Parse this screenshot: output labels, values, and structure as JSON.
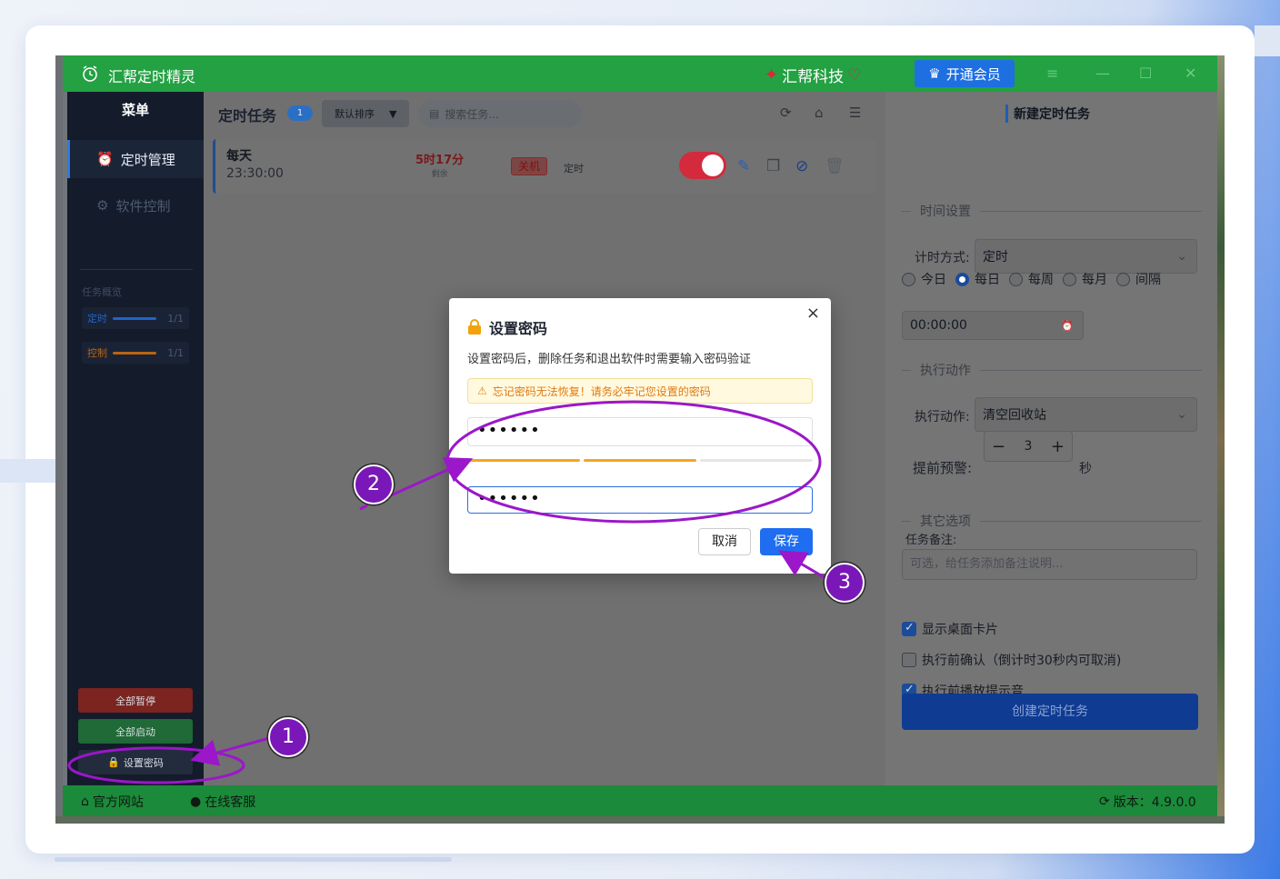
{
  "app": {
    "title": "汇帮定时精灵",
    "brand": "汇帮科技",
    "vip_button": "开通会员"
  },
  "sidebar": {
    "header": "菜单",
    "items": [
      {
        "label": "定时管理",
        "active": true
      },
      {
        "label": "软件控制",
        "active": false
      }
    ],
    "overview_title": "任务概览",
    "overview": [
      {
        "label": "定时",
        "value": "1/1",
        "color": "#1f64c9"
      },
      {
        "label": "控制",
        "value": "1/1",
        "color": "#b86414"
      }
    ],
    "buttons": {
      "pause_all": "全部暂停",
      "start_all": "全部启动",
      "set_password": "设置密码"
    }
  },
  "main": {
    "title": "定时任务",
    "count": "1",
    "sort_label": "默认排序",
    "search_placeholder": "搜索任务...",
    "task": {
      "frequency": "每天",
      "time": "23:30:00",
      "remaining": "5时17分",
      "remaining_label": "剩余",
      "action_tag": "关机",
      "type_tag": "定时",
      "enabled": true
    }
  },
  "right": {
    "title": "新建定时任务",
    "section_time": "时间设置",
    "timing_label": "计时方式:",
    "timing_value": "定时",
    "radios": [
      {
        "label": "今日",
        "checked": false
      },
      {
        "label": "每日",
        "checked": true
      },
      {
        "label": "每周",
        "checked": false
      },
      {
        "label": "每月",
        "checked": false
      },
      {
        "label": "间隔",
        "checked": false
      }
    ],
    "time_value": "00:00:00",
    "section_action": "执行动作",
    "action_label": "执行动作:",
    "action_value": "清空回收站",
    "warn_label": "提前预警:",
    "warn_value": "3",
    "warn_unit": "秒",
    "section_other": "其它选项",
    "note_label": "任务备注:",
    "note_placeholder": "可选，给任务添加备注说明...",
    "checks": [
      {
        "label": "显示桌面卡片",
        "checked": true
      },
      {
        "label": "执行前确认（倒计时30秒内可取消)",
        "checked": false
      },
      {
        "label": "执行前播放提示音",
        "checked": true
      }
    ],
    "create_button": "创建定时任务"
  },
  "footer": {
    "website": "官方网站",
    "support": "在线客服",
    "version": "版本：4.9.0.0"
  },
  "modal": {
    "title": "设置密码",
    "description": "设置密码后，删除任务和退出软件时需要输入密码验证",
    "warning": "忘记密码无法恢复！请务必牢记您设置的密码",
    "password_value": "••••••",
    "confirm_value": "••••••",
    "cancel": "取消",
    "save": "保存"
  },
  "annotations": {
    "step1": "1",
    "step2": "2",
    "step3": "3"
  },
  "colors": {
    "accent_green": "#23a143",
    "annotation_purple": "#9b17c9",
    "primary_blue": "#1f6df0"
  }
}
